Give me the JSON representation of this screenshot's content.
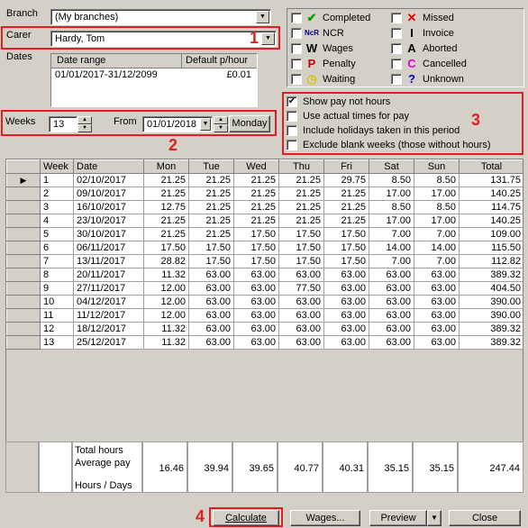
{
  "branch": {
    "label": "Branch",
    "value": "(My branches)"
  },
  "carer": {
    "label": "Carer",
    "value": "Hardy, Tom"
  },
  "dates": {
    "label": "Dates",
    "headers": [
      "Date range",
      "Default p/hour"
    ],
    "row": [
      "01/01/2017-31/12/2099",
      "£0.01"
    ]
  },
  "weeks": {
    "label": "Weeks",
    "value": "13",
    "from_label": "From",
    "from_value": "01/01/2018",
    "day_button": "Monday"
  },
  "status": {
    "left": [
      {
        "label": "Completed",
        "icon": "checkmark-icon",
        "color": "#00a000"
      },
      {
        "label": "NCR",
        "icon": "ncr-icon",
        "color": "#000080"
      },
      {
        "label": "Wages",
        "icon": "wages-w-icon",
        "color": "#000000"
      },
      {
        "label": "Penalty",
        "icon": "penalty-p-icon",
        "color": "#c00000"
      },
      {
        "label": "Waiting",
        "icon": "clock-icon",
        "color": "#e0c000"
      }
    ],
    "right": [
      {
        "label": "Missed",
        "icon": "cross-icon",
        "color": "#e00000"
      },
      {
        "label": "Invoice",
        "icon": "invoice-i-icon",
        "color": "#000000"
      },
      {
        "label": "Aborted",
        "icon": "aborted-a-icon",
        "color": "#000000"
      },
      {
        "label": "Cancelled",
        "icon": "cancelled-c-icon",
        "color": "#e000e0"
      },
      {
        "label": "Unknown",
        "icon": "question-icon",
        "color": "#0000c0"
      }
    ]
  },
  "options": [
    {
      "label": "Show pay not hours",
      "checked": true
    },
    {
      "label": "Use actual times for pay",
      "checked": false
    },
    {
      "label": "Include holidays taken in this period",
      "checked": false
    },
    {
      "label": "Exclude blank weeks (those without hours)",
      "checked": false
    }
  ],
  "annotations": [
    "1",
    "2",
    "3",
    "4"
  ],
  "table": {
    "headers": [
      "Week",
      "Date",
      "Mon",
      "Tue",
      "Wed",
      "Thu",
      "Fri",
      "Sat",
      "Sun",
      "Total"
    ],
    "rows": [
      [
        "1",
        "02/10/2017",
        "21.25",
        "21.25",
        "21.25",
        "21.25",
        "29.75",
        "8.50",
        "8.50",
        "131.75"
      ],
      [
        "2",
        "09/10/2017",
        "21.25",
        "21.25",
        "21.25",
        "21.25",
        "21.25",
        "17.00",
        "17.00",
        "140.25"
      ],
      [
        "3",
        "16/10/2017",
        "12.75",
        "21.25",
        "21.25",
        "21.25",
        "21.25",
        "8.50",
        "8.50",
        "114.75"
      ],
      [
        "4",
        "23/10/2017",
        "21.25",
        "21.25",
        "21.25",
        "21.25",
        "21.25",
        "17.00",
        "17.00",
        "140.25"
      ],
      [
        "5",
        "30/10/2017",
        "21.25",
        "21.25",
        "17.50",
        "17.50",
        "17.50",
        "7.00",
        "7.00",
        "109.00"
      ],
      [
        "6",
        "06/11/2017",
        "17.50",
        "17.50",
        "17.50",
        "17.50",
        "17.50",
        "14.00",
        "14.00",
        "115.50"
      ],
      [
        "7",
        "13/11/2017",
        "28.82",
        "17.50",
        "17.50",
        "17.50",
        "17.50",
        "7.00",
        "7.00",
        "112.82"
      ],
      [
        "8",
        "20/11/2017",
        "11.32",
        "63.00",
        "63.00",
        "63.00",
        "63.00",
        "63.00",
        "63.00",
        "389.32"
      ],
      [
        "9",
        "27/11/2017",
        "12.00",
        "63.00",
        "63.00",
        "77.50",
        "63.00",
        "63.00",
        "63.00",
        "404.50"
      ],
      [
        "10",
        "04/12/2017",
        "12.00",
        "63.00",
        "63.00",
        "63.00",
        "63.00",
        "63.00",
        "63.00",
        "390.00"
      ],
      [
        "11",
        "11/12/2017",
        "12.00",
        "63.00",
        "63.00",
        "63.00",
        "63.00",
        "63.00",
        "63.00",
        "390.00"
      ],
      [
        "12",
        "18/12/2017",
        "11.32",
        "63.00",
        "63.00",
        "63.00",
        "63.00",
        "63.00",
        "63.00",
        "389.32"
      ],
      [
        "13",
        "25/12/2017",
        "11.32",
        "63.00",
        "63.00",
        "63.00",
        "63.00",
        "63.00",
        "63.00",
        "389.32"
      ]
    ],
    "footer_labels": [
      "Total hours",
      "Average pay",
      "Hours / Days"
    ],
    "footer_values": [
      "16.46",
      "39.94",
      "39.65",
      "40.77",
      "40.31",
      "35.15",
      "35.15",
      "247.44"
    ]
  },
  "buttons": {
    "calculate": "Calculate",
    "wages": "Wages...",
    "preview": "Preview",
    "close": "Close"
  }
}
